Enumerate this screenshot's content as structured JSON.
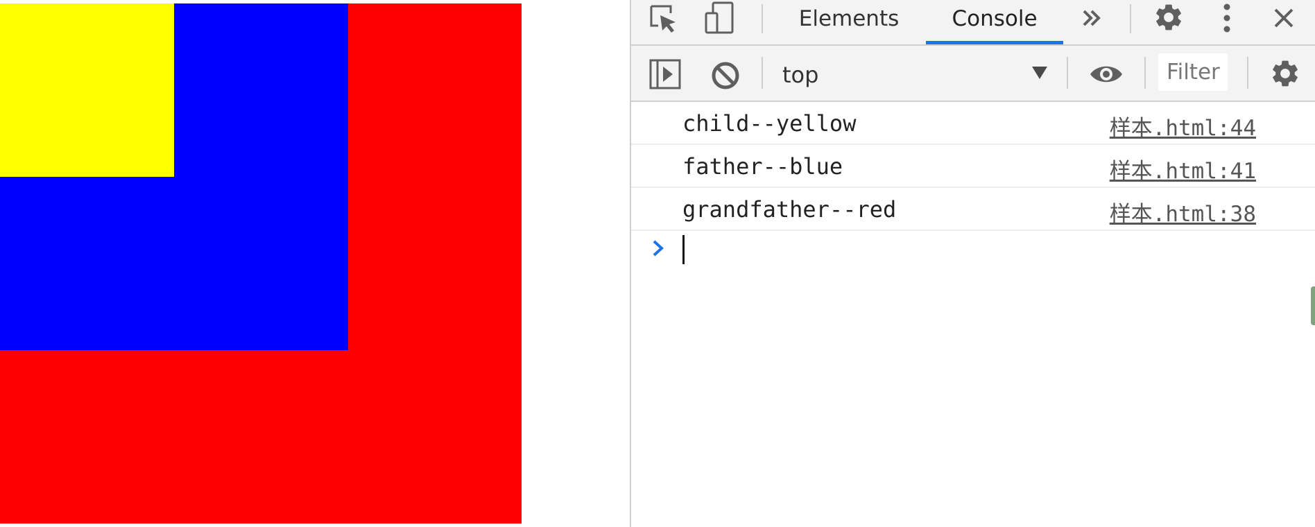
{
  "page": {
    "boxes": [
      {
        "name": "grandfather",
        "color": "#ff0000"
      },
      {
        "name": "father",
        "color": "#0000ff"
      },
      {
        "name": "child",
        "color": "#ffff00"
      }
    ]
  },
  "devtools": {
    "tabs": [
      {
        "label": "Elements",
        "active": false
      },
      {
        "label": "Console",
        "active": true
      }
    ],
    "icons": {
      "inspect": "inspect-element-icon",
      "device": "device-toolbar-icon",
      "more_tabs": "chevron-double-right-icon",
      "settings": "gear-icon",
      "menu": "kebab-menu-icon",
      "close": "close-icon",
      "sidebar": "sidebar-toggle-icon",
      "clear": "clear-console-icon",
      "eye": "eye-icon",
      "console_settings": "gear-icon"
    },
    "toolbar": {
      "context": "top",
      "filter_placeholder": "Filter"
    },
    "accent_color": "#1a73e8"
  },
  "console": {
    "messages": [
      {
        "text": "child--yellow",
        "source": "样本.html:44"
      },
      {
        "text": "father--blue",
        "source": "样本.html:41"
      },
      {
        "text": "grandfather--red",
        "source": "样本.html:38"
      }
    ]
  }
}
